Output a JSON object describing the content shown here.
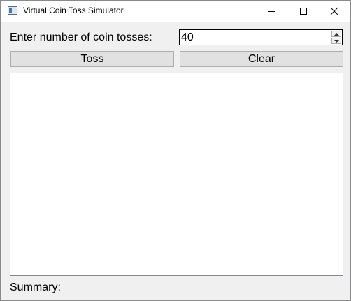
{
  "window": {
    "title": "Virtual Coin Toss Simulator",
    "icons": {
      "app": "app-window-icon",
      "minimize": "minimize-icon",
      "maximize": "maximize-icon",
      "close": "close-icon"
    }
  },
  "form": {
    "count_label": "Enter number of coin tosses:",
    "count_value": "40",
    "toss_label": "Toss",
    "clear_label": "Clear",
    "summary_label": "Summary:"
  },
  "colors": {
    "window_bg": "#f0f0f0",
    "titlebar_bg": "#ffffff",
    "button_bg": "#e1e1e1"
  }
}
